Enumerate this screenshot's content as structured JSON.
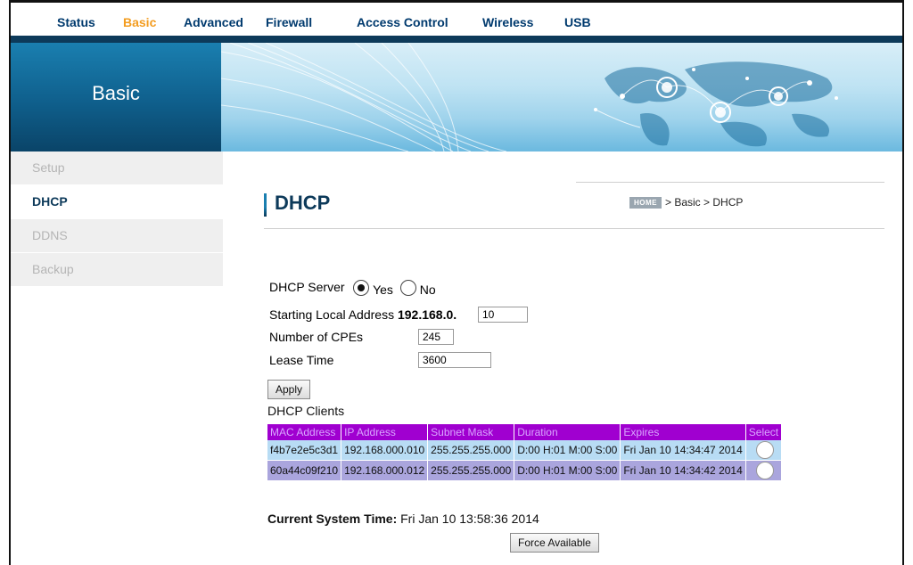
{
  "nav": {
    "items": [
      "Status",
      "Basic",
      "Advanced",
      "Firewall",
      "Access Control",
      "Wireless",
      "USB"
    ],
    "active": "Basic"
  },
  "banner": {
    "title": "Basic"
  },
  "sidebar": {
    "items": [
      "Setup",
      "DHCP",
      "DDNS",
      "Backup"
    ],
    "active": "DHCP"
  },
  "page": {
    "title": "DHCP",
    "breadcrumb": {
      "home": "HOME",
      "path": "> Basic > DHCP"
    }
  },
  "form": {
    "dhcp_server_label": "DHCP Server",
    "yes_label": "Yes",
    "no_label": "No",
    "dhcp_server_value": "Yes",
    "start_addr_label": "Starting Local Address",
    "start_addr_prefix": "192.168.0.",
    "start_addr_value": "10",
    "num_cpes_label": "Number of CPEs",
    "num_cpes_value": "245",
    "lease_time_label": "Lease Time",
    "lease_time_value": "3600",
    "apply_label": "Apply"
  },
  "clients": {
    "label": "DHCP Clients",
    "columns": [
      "MAC Address",
      "IP Address",
      "Subnet Mask",
      "Duration",
      "Expires",
      "Select"
    ],
    "rows": [
      [
        "f4b7e2e5c3d1",
        "192.168.000.010",
        "255.255.255.000",
        "D:00 H:01 M:00 S:00",
        "Fri Jan 10 14:34:47 2014"
      ],
      [
        "60a44c09f210",
        "192.168.000.012",
        "255.255.255.000",
        "D:00 H:01 M:00 S:00",
        "Fri Jan 10 14:34:42 2014"
      ]
    ]
  },
  "system_time": {
    "label": "Current System Time:",
    "value": "Fri Jan 10 13:58:36 2014"
  },
  "force_available_label": "Force Available",
  "colors": {
    "nav_active": "#f39c1f",
    "nav": "#003a6e",
    "table_header": "#a000d0"
  }
}
